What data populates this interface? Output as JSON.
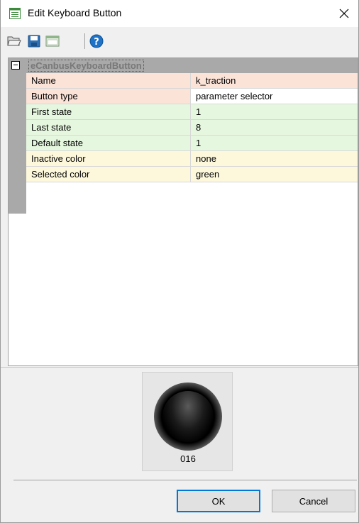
{
  "window": {
    "title": "Edit Keyboard Button",
    "app_icon": "window-list-icon",
    "close_icon": "close-icon"
  },
  "toolbar": {
    "buttons": [
      {
        "icon": "open-folder-icon"
      },
      {
        "icon": "save-icon"
      },
      {
        "icon": "window-icon"
      },
      {
        "icon": "help-icon"
      }
    ]
  },
  "property_grid": {
    "category": "eCanbusKeyboardButton",
    "rows": [
      {
        "name": "Name",
        "value": "k_traction",
        "name_bg": "#fbe3d8",
        "value_bg": "#fbe3d8"
      },
      {
        "name": "Button type",
        "value": "parameter selector",
        "name_bg": "#fbe3d8",
        "value_bg": "#ffffff"
      },
      {
        "name": "First state",
        "value": "1",
        "name_bg": "#e6f7df",
        "value_bg": "#e6f7df"
      },
      {
        "name": "Last state",
        "value": "8",
        "name_bg": "#e6f7df",
        "value_bg": "#e6f7df"
      },
      {
        "name": "Default state",
        "value": "1",
        "name_bg": "#e6f7df",
        "value_bg": "#e6f7df"
      },
      {
        "name": "Inactive color",
        "value": "none",
        "name_bg": "#fdf8dc",
        "value_bg": "#fdf8dc"
      },
      {
        "name": "Selected color",
        "value": "green",
        "name_bg": "#fdf8dc",
        "value_bg": "#fdf8dc"
      }
    ]
  },
  "preview": {
    "label": "016"
  },
  "buttons": {
    "ok_label": "OK",
    "cancel_label": "Cancel"
  }
}
